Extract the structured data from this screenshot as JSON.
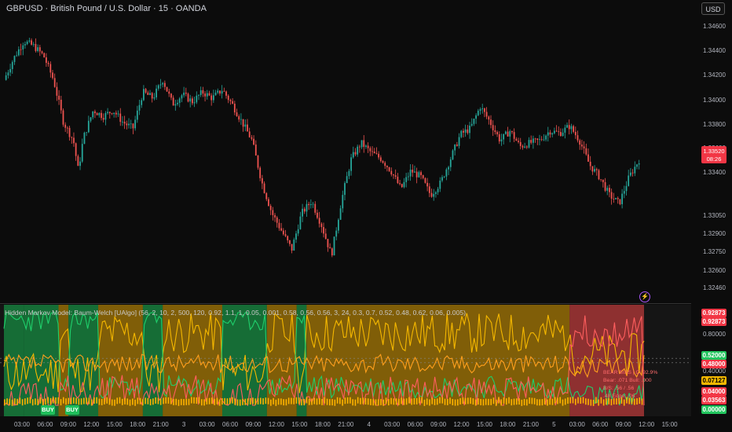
{
  "header": {
    "symbol_title": "GBPUSD · British Pound / U.S. Dollar · 15 · OANDA",
    "currency": "USD"
  },
  "price_scale": [
    "1.34600",
    "1.34400",
    "1.34200",
    "1.34000",
    "1.33800",
    "1.33600",
    "1.33400",
    "1.33050",
    "1.32900",
    "1.32750",
    "1.32600",
    "1.32460"
  ],
  "current_price": {
    "value": "1.33520",
    "countdown": "08:26",
    "color": "#f23645"
  },
  "indicator": {
    "title": "Hidden Markov Model: Baum-Welch [UAlgo] (56, 2, 10, 2, 500, 120, 0.92, 1.1, 1, 0.05, 0.001, 0.58, 0.56, 0.56, 3, 24, 0.3, 0.7, 0.52, 0.48, 0.62, 0.06, 0.005)",
    "scale": [
      "0.80000",
      "0.40000"
    ],
    "value_tags": [
      {
        "text": "0.92873",
        "color": "#f23645"
      },
      {
        "text": "0.92873",
        "color": "#f23645"
      },
      {
        "text": "0.52000",
        "color": "#22c55e"
      },
      {
        "text": "0.48000",
        "color": "#f23645"
      },
      {
        "text": "0.07127",
        "color": "#f5b800"
      },
      {
        "text": "0.04000",
        "color": "#f23645"
      },
      {
        "text": "0.03563",
        "color": "#f23645"
      },
      {
        "text": "0.00000",
        "color": "#22c55e"
      }
    ],
    "bias_table": [
      "BEAR BIAS | C: 92.9%",
      "Bear: .071  Bull: .000",
      "B/S: .56 / .56",
      ".48  Edge: .06"
    ],
    "buy_label": "BUY"
  },
  "time_axis": [
    "03:00",
    "06:00",
    "09:00",
    "12:00",
    "15:00",
    "18:00",
    "21:00",
    "3",
    "03:00",
    "06:00",
    "09:00",
    "12:00",
    "15:00",
    "18:00",
    "21:00",
    "4",
    "03:00",
    "06:00",
    "09:00",
    "12:00",
    "15:00",
    "18:00",
    "21:00",
    "5",
    "03:00",
    "06:00",
    "09:00",
    "12:00",
    "15:00"
  ],
  "colors": {
    "up": "#26a69a",
    "down": "#ef5350",
    "bull_zone": "#16a34a",
    "neutral_zone": "#c28a00",
    "bear_zone": "#d94141"
  },
  "chart_data": [
    {
      "type": "candlestick",
      "title": "GBPUSD · British Pound / U.S. Dollar · 15 · OANDA",
      "ylim": [
        1.3246,
        1.3475
      ],
      "close_path": [
        [
          0,
          1.342
        ],
        [
          2,
          1.3438
        ],
        [
          4,
          1.3452
        ],
        [
          6,
          1.3448
        ],
        [
          8,
          1.344
        ],
        [
          10,
          1.342
        ],
        [
          12,
          1.3385
        ],
        [
          14,
          1.337
        ],
        [
          15,
          1.3345
        ],
        [
          16,
          1.3372
        ],
        [
          18,
          1.3395
        ],
        [
          20,
          1.339
        ],
        [
          22,
          1.3395
        ],
        [
          24,
          1.3385
        ],
        [
          26,
          1.338
        ],
        [
          28,
          1.341
        ],
        [
          30,
          1.3405
        ],
        [
          32,
          1.342
        ],
        [
          34,
          1.34
        ],
        [
          36,
          1.3408
        ],
        [
          38,
          1.3402
        ],
        [
          40,
          1.341
        ],
        [
          42,
          1.3405
        ],
        [
          44,
          1.3412
        ],
        [
          46,
          1.34
        ],
        [
          48,
          1.3385
        ],
        [
          50,
          1.337
        ],
        [
          52,
          1.3335
        ],
        [
          54,
          1.331
        ],
        [
          56,
          1.3295
        ],
        [
          58,
          1.328
        ],
        [
          60,
          1.331
        ],
        [
          62,
          1.332
        ],
        [
          64,
          1.33
        ],
        [
          66,
          1.3275
        ],
        [
          68,
          1.332
        ],
        [
          70,
          1.3355
        ],
        [
          72,
          1.3368
        ],
        [
          74,
          1.336
        ],
        [
          76,
          1.3355
        ],
        [
          78,
          1.3345
        ],
        [
          80,
          1.333
        ],
        [
          82,
          1.3345
        ],
        [
          84,
          1.334
        ],
        [
          86,
          1.3325
        ],
        [
          88,
          1.3335
        ],
        [
          90,
          1.3355
        ],
        [
          92,
          1.3375
        ],
        [
          94,
          1.338
        ],
        [
          96,
          1.3398
        ],
        [
          98,
          1.3385
        ],
        [
          100,
          1.337
        ],
        [
          102,
          1.3378
        ],
        [
          104,
          1.3365
        ],
        [
          106,
          1.3368
        ],
        [
          108,
          1.337
        ],
        [
          110,
          1.3378
        ],
        [
          112,
          1.3376
        ],
        [
          114,
          1.3382
        ],
        [
          116,
          1.337
        ],
        [
          118,
          1.335
        ],
        [
          120,
          1.334
        ],
        [
          122,
          1.3325
        ],
        [
          124,
          1.3318
        ],
        [
          126,
          1.334
        ],
        [
          128,
          1.3354
        ]
      ]
    },
    {
      "type": "area",
      "title": "Hidden Markov Model: Baum-Welch [UAlgo]",
      "ylim": [
        0,
        1
      ],
      "regimes": [
        {
          "from": 0,
          "to": 4,
          "state": "bull"
        },
        {
          "from": 4,
          "to": 11,
          "state": "bull"
        },
        {
          "from": 11,
          "to": 13,
          "state": "neutral"
        },
        {
          "from": 13,
          "to": 19,
          "state": "bull"
        },
        {
          "from": 19,
          "to": 28,
          "state": "neutral"
        },
        {
          "from": 28,
          "to": 32,
          "state": "bull"
        },
        {
          "from": 32,
          "to": 44,
          "state": "neutral"
        },
        {
          "from": 44,
          "to": 53,
          "state": "bull"
        },
        {
          "from": 53,
          "to": 59,
          "state": "neutral"
        },
        {
          "from": 59,
          "to": 61,
          "state": "bull"
        },
        {
          "from": 61,
          "to": 114,
          "state": "neutral"
        },
        {
          "from": 114,
          "to": 129,
          "state": "bear"
        }
      ]
    }
  ]
}
